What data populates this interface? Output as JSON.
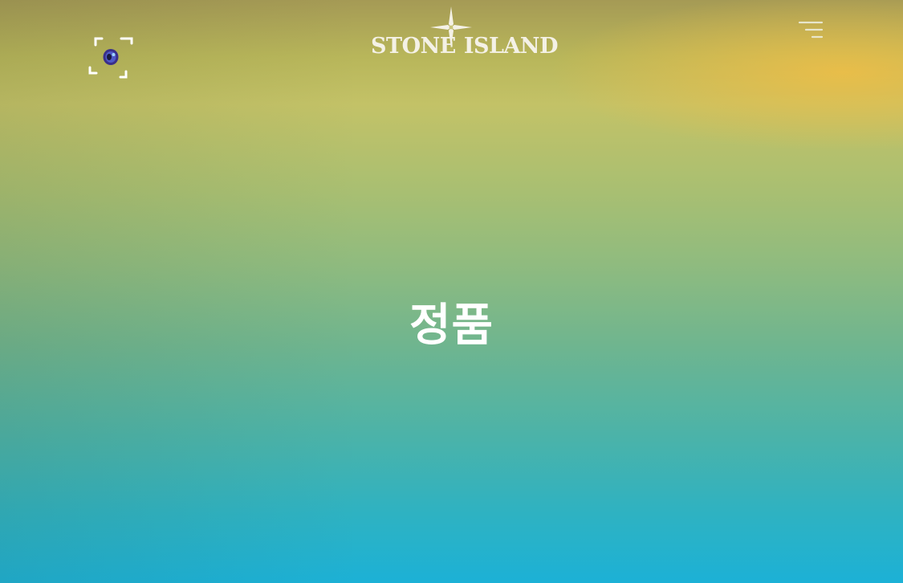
{
  "header": {
    "brand_left": "STONE",
    "brand_right": "ISLAND",
    "scan_icon": "scan-eye-icon",
    "menu_icon": "menu-lines-icon",
    "logo_icon": "compass-star-icon"
  },
  "main": {
    "title": "정품"
  },
  "colors": {
    "background_top": "#a59a55",
    "background_middle": "#8fbb7f",
    "background_bottom": "#1cb1d6",
    "accent_warm": "#f0be46",
    "text": "#ffffff"
  }
}
